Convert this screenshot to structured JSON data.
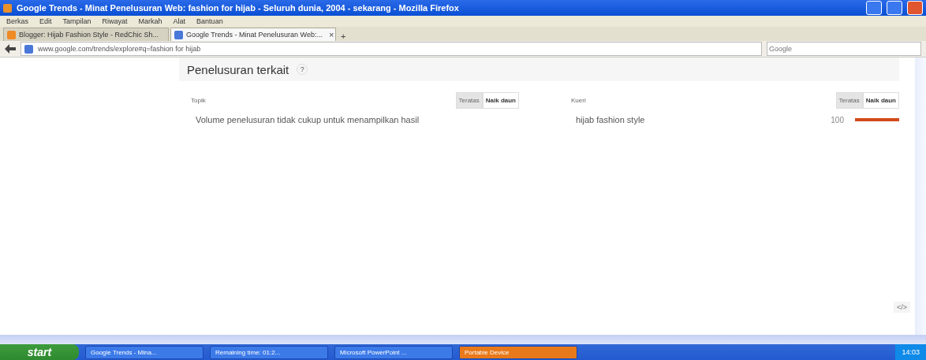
{
  "window": {
    "title": "Google Trends - Minat Penelusuran Web: fashion for hijab - Seluruh dunia, 2004 - sekarang - Mozilla Firefox"
  },
  "menu": [
    "Berkas",
    "Edit",
    "Tampilan",
    "Riwayat",
    "Markah",
    "Alat",
    "Bantuan"
  ],
  "tabs": [
    {
      "label": "Blogger: Hijab Fashion Style - RedChic Sh...",
      "selected": false
    },
    {
      "label": "Google Trends - Minat Penelusuran Web:...",
      "selected": true
    }
  ],
  "tab_close": "×",
  "new_tab": "+",
  "address": {
    "value": "www.google.com/trends/explore#q=fashion for hijab"
  },
  "search": {
    "placeholder": "Google"
  },
  "section": {
    "title": "Penelusuran terkait",
    "help": "?"
  },
  "panels": [
    {
      "heading": "Topik",
      "toggles": [
        {
          "label": "Teratas",
          "selected": true
        },
        {
          "label": "Naik daun",
          "selected": false
        }
      ],
      "message": "Volume penelusuran tidak cukup untuk menampilkan hasil"
    },
    {
      "heading": "Kueri",
      "toggles": [
        {
          "label": "Teratas",
          "selected": true
        },
        {
          "label": "Naik daun",
          "selected": false
        }
      ],
      "rows": [
        {
          "query": "hijab fashion style",
          "value": "100",
          "level": 1
        }
      ]
    }
  ],
  "embed": "</>",
  "taskbar": {
    "start": "start",
    "items": [
      {
        "label": "Google Trends - Mina...",
        "selected": false
      },
      {
        "label": "Remaining time: 01:2...",
        "selected": false
      },
      {
        "label": "Microsoft PowerPoint ...",
        "selected": false
      },
      {
        "label": "Portable Device",
        "selected": true
      }
    ],
    "clock": "14:03"
  }
}
